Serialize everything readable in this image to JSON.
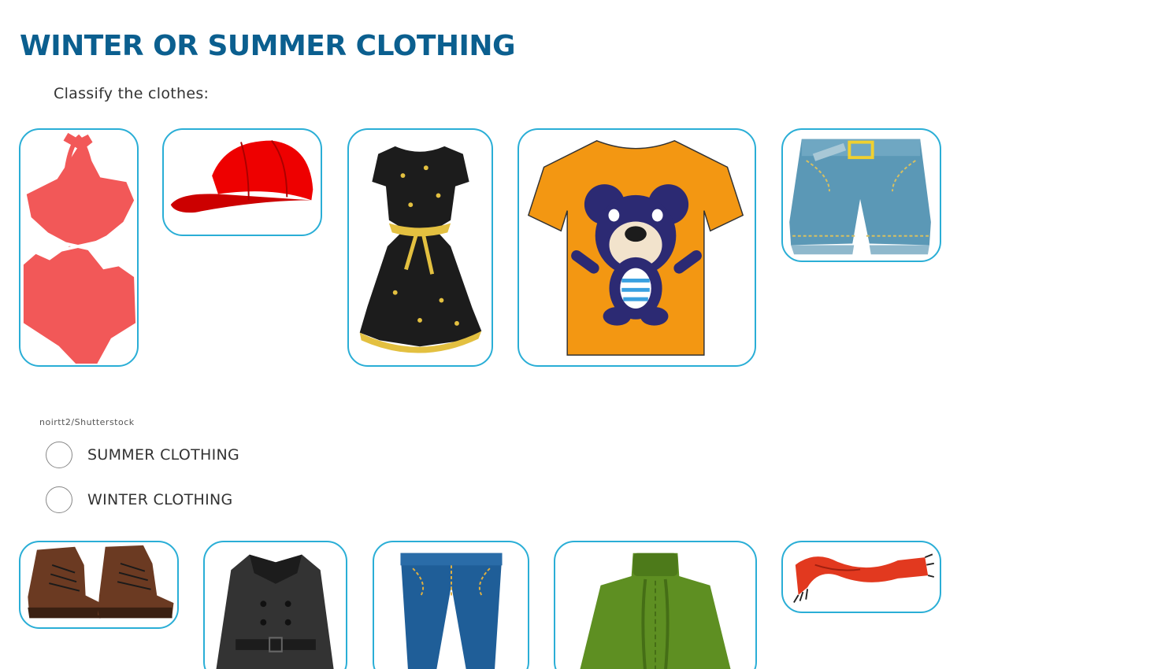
{
  "title": "WINTER OR SUMMER CLOTHING",
  "instruction": "Classify the clothes:",
  "image_credit": "noirtt2/Shutterstock",
  "accent_color": "#2aaed6",
  "title_color": "#0b5f8f",
  "options": [
    {
      "label": "SUMMER CLOTHING",
      "selected": false
    },
    {
      "label": "WINTER CLOTHING",
      "selected": false
    }
  ],
  "cards": [
    {
      "name": "swimsuit-card",
      "icon": "swimsuit-icon"
    },
    {
      "name": "cap-card",
      "icon": "cap-icon"
    },
    {
      "name": "dress-card",
      "icon": "dress-icon"
    },
    {
      "name": "tshirt-card",
      "icon": "tshirt-icon"
    },
    {
      "name": "shorts-card",
      "icon": "shorts-icon"
    },
    {
      "name": "boots-card",
      "icon": "boots-icon"
    },
    {
      "name": "coat-card",
      "icon": "coat-icon"
    },
    {
      "name": "jeans-card",
      "icon": "jeans-icon"
    },
    {
      "name": "sweater-card",
      "icon": "sweater-icon"
    },
    {
      "name": "scarf-card",
      "icon": "scarf-icon"
    }
  ]
}
